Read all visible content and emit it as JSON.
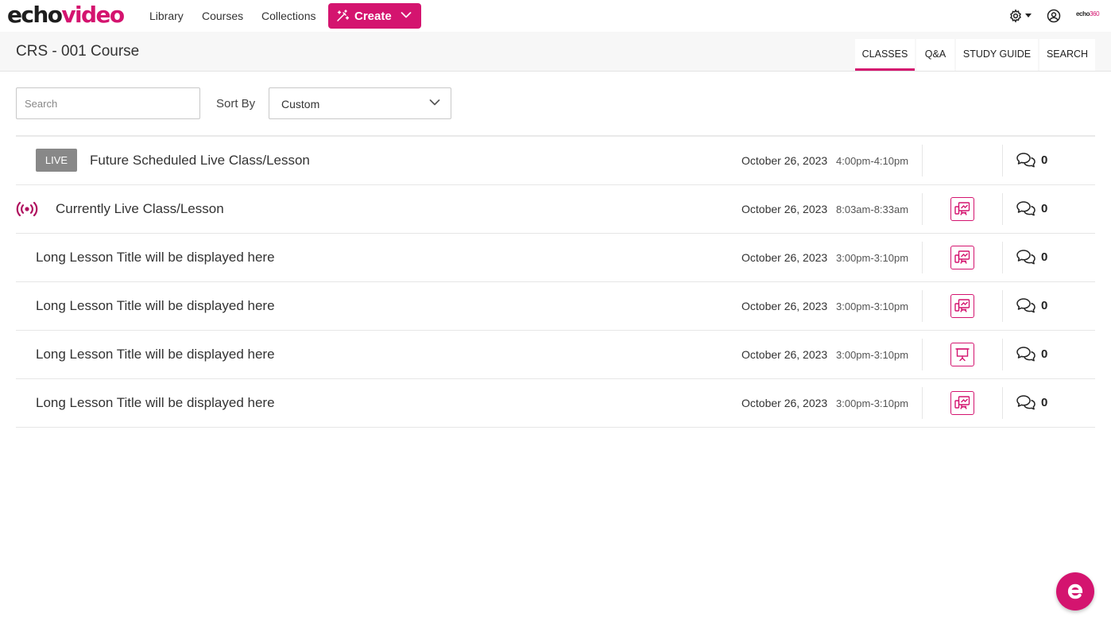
{
  "brand": {
    "logo_part1": "echo",
    "logo_part2": "video",
    "small_logo_part1": "echo",
    "small_logo_part2": "360",
    "accent": "#d4146f"
  },
  "nav": {
    "items": [
      "Library",
      "Courses",
      "Collections"
    ],
    "create_label": "Create"
  },
  "course": {
    "title": "CRS - 001 Course"
  },
  "tabs": [
    {
      "label": "CLASSES",
      "active": true
    },
    {
      "label": "Q&A",
      "active": false
    },
    {
      "label": "STUDY GUIDE",
      "active": false
    },
    {
      "label": "SEARCH",
      "active": false
    }
  ],
  "controls": {
    "search_placeholder": "Search",
    "sort_label": "Sort By",
    "sort_value": "Custom"
  },
  "lessons": [
    {
      "title": "Future Scheduled Live Class/Lesson",
      "badge": "LIVE",
      "date": "October 26, 2023",
      "time": "4:00pm-4:10pm",
      "media": "none",
      "comments": "0"
    },
    {
      "title": "Currently Live Class/Lesson",
      "live_now": true,
      "date": "October 26, 2023",
      "time": "8:03am-8:33am",
      "media": "video-icon",
      "comments": "0"
    },
    {
      "title": "Long Lesson Title will be displayed here",
      "date": "October 26, 2023",
      "time": "3:00pm-3:10pm",
      "media": "video-icon",
      "comments": "0"
    },
    {
      "title": "Long Lesson Title will be displayed here",
      "date": "October 26, 2023",
      "time": "3:00pm-3:10pm",
      "media": "video-icon",
      "comments": "0"
    },
    {
      "title": "Long Lesson Title will be displayed here",
      "date": "October 26, 2023",
      "time": "3:00pm-3:10pm",
      "media": "presentation-icon",
      "comments": "0"
    },
    {
      "title": "Long Lesson Title will be displayed here",
      "date": "October 26, 2023",
      "time": "3:00pm-3:10pm",
      "media": "video-icon",
      "comments": "0"
    }
  ]
}
